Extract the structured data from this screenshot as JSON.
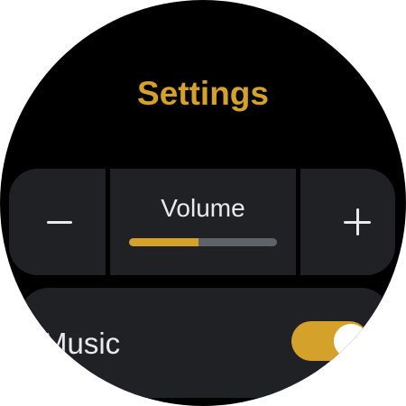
{
  "screen": {
    "title": "Settings"
  },
  "volume": {
    "label": "Volume",
    "decrease_icon": "minus-icon",
    "increase_icon": "plus-icon",
    "level": 0.47
  },
  "music": {
    "label": "Music",
    "toggle_on": true
  },
  "colors": {
    "accent": "#d4a12a",
    "background": "#000000",
    "card": "#202124",
    "text": "#e8eaed",
    "track": "#5f6368"
  }
}
